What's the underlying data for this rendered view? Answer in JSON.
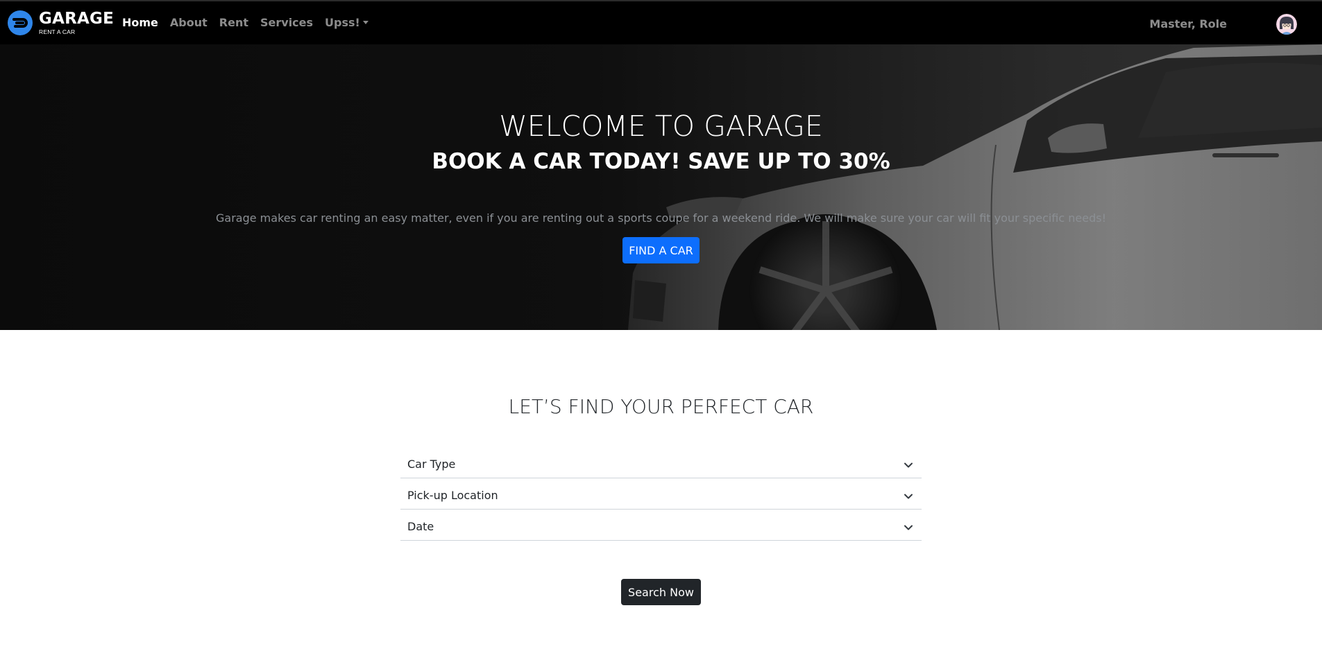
{
  "brand": {
    "name": "GARAGE",
    "tagline": "RENT A CAR",
    "logo_icon": "garage-logo-icon"
  },
  "nav": {
    "items": [
      {
        "label": "Home",
        "active": true
      },
      {
        "label": "About"
      },
      {
        "label": "Rent"
      },
      {
        "label": "Services"
      },
      {
        "label": "Upss!",
        "dropdown": true
      }
    ],
    "user_name": "Master, Role",
    "avatar_icon": "user-avatar-icon"
  },
  "hero": {
    "title": "WELCOME TO GARAGE",
    "subtitle": "BOOK A CAR TODAY! SAVE UP TO 30%",
    "description": "Garage makes car renting an easy matter, even if you are renting out a sports coupe for a weekend ride. We will make sure your car will fit your specific needs!",
    "cta_label": "FIND A CAR"
  },
  "search": {
    "title": "LET’S FIND YOUR PERFECT CAR",
    "fields": [
      {
        "label": "Car Type",
        "icon": "chevron-down-icon"
      },
      {
        "label": "Pick-up Location",
        "icon": "chevron-down-icon"
      },
      {
        "label": "Date",
        "icon": "chevron-down-icon"
      }
    ],
    "submit_label": "Search Now"
  },
  "colors": {
    "navbar_bg": "#000000",
    "primary": "#0d6efd",
    "dark_button": "#212529",
    "logo_blue": "#2f86ea"
  }
}
